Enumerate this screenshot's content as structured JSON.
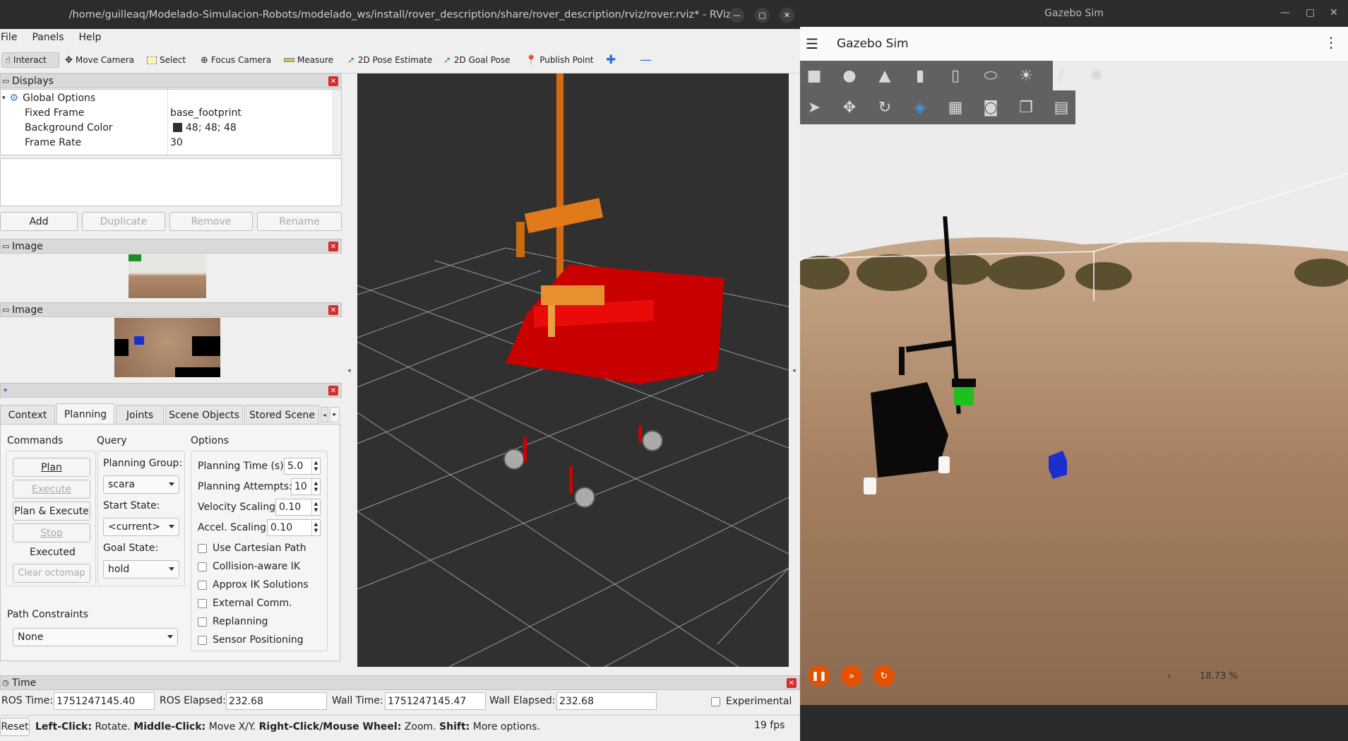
{
  "rviz": {
    "title": "/home/guilleaq/Modelado-Simulacion-Robots/modelado_ws/install/rover_description/share/rover_description/rviz/rover.rviz* - RViz",
    "menu": [
      "File",
      "Panels",
      "Help"
    ],
    "toolbar": {
      "interact": "Interact",
      "move_camera": "Move Camera",
      "select": "Select",
      "focus_camera": "Focus Camera",
      "measure": "Measure",
      "pose_estimate": "2D Pose Estimate",
      "goal_pose": "2D Goal Pose",
      "publish_point": "Publish Point"
    },
    "displays": {
      "header": "Displays",
      "global_options": "Global Options",
      "rows": [
        {
          "name": "Fixed Frame",
          "value": "base_footprint"
        },
        {
          "name": "Background Color",
          "value": "48; 48; 48"
        },
        {
          "name": "Frame Rate",
          "value": "30"
        }
      ],
      "buttons": {
        "add": "Add",
        "duplicate": "Duplicate",
        "remove": "Remove",
        "rename": "Rename"
      }
    },
    "image1": {
      "header": "Image"
    },
    "image2": {
      "header": "Image"
    },
    "motion": {
      "tabs": [
        "Context",
        "Planning",
        "Joints",
        "Scene Objects",
        "Stored Scene"
      ],
      "active_tab": "Planning",
      "commands": {
        "title": "Commands",
        "plan": "Plan",
        "execute": "Execute",
        "plan_execute": "Plan & Execute",
        "stop": "Stop",
        "status": "Executed",
        "clear_octomap": "Clear octomap"
      },
      "query": {
        "title": "Query",
        "planning_group_label": "Planning Group:",
        "planning_group": "scara",
        "start_state_label": "Start State:",
        "start_state": "<current>",
        "goal_state_label": "Goal State:",
        "goal_state": "hold"
      },
      "options": {
        "title": "Options",
        "planning_time_label": "Planning Time (s):",
        "planning_time": "5.0",
        "planning_attempts_label": "Planning Attempts:",
        "planning_attempts": "10",
        "velocity_scaling_label": "Velocity Scaling:",
        "velocity_scaling": "0.10",
        "accel_scaling_label": "Accel. Scaling:",
        "accel_scaling": "0.10",
        "checks": [
          "Use Cartesian Path",
          "Collision-aware IK",
          "Approx IK Solutions",
          "External Comm.",
          "Replanning",
          "Sensor Positioning"
        ]
      },
      "path_constraints": {
        "title": "Path Constraints",
        "value": "None"
      }
    },
    "time": {
      "header": "Time",
      "ros_time_label": "ROS Time:",
      "ros_time": "1751247145.40",
      "ros_elapsed_label": "ROS Elapsed:",
      "ros_elapsed": "232.68",
      "wall_time_label": "Wall Time:",
      "wall_time": "1751247145.47",
      "wall_elapsed_label": "Wall Elapsed:",
      "wall_elapsed": "232.68",
      "experimental": "Experimental"
    },
    "status": {
      "reset": "Reset",
      "hint_left_b": "Left-Click:",
      "hint_left": "Rotate.",
      "hint_mid_b": "Middle-Click:",
      "hint_mid": "Move X/Y.",
      "hint_right_b": "Right-Click/Mouse Wheel:",
      "hint_right": "Zoom.",
      "hint_shift_b": "Shift:",
      "hint_shift": "More options.",
      "fps": "19 fps"
    }
  },
  "gazebo": {
    "window_title": "Gazebo Sim",
    "app_title": "Gazebo Sim",
    "rtf": "18.73 %"
  },
  "colors": {
    "accent_orange": "#e65100",
    "rviz_bg": "#303030",
    "rover_red": "#cc0000"
  }
}
